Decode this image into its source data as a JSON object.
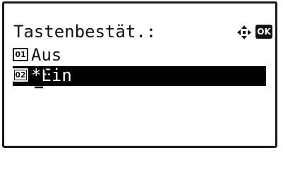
{
  "panel": {
    "title": "Tastenbestät.:",
    "nav_icon": "four-way-arrow-icon",
    "ok_label": "OK"
  },
  "options": [
    {
      "number": "01",
      "label": "Aus",
      "selected": false
    },
    {
      "number": "02",
      "label": "*Ein",
      "selected": true
    }
  ],
  "colors": {
    "foreground": "#111111",
    "background": "#ffffff",
    "selection": "#000000"
  }
}
